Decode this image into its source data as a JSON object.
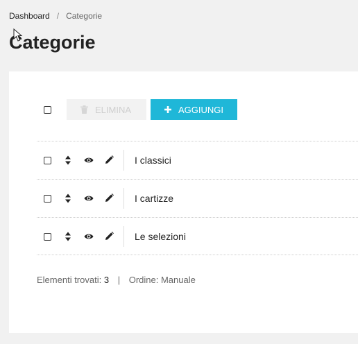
{
  "breadcrumb": {
    "home": "Dashboard",
    "separator": "/",
    "current": "Categorie"
  },
  "page": {
    "title": "Categorie"
  },
  "toolbar": {
    "delete_label": "ELIMINA",
    "add_label": "AGGIUNGI"
  },
  "categories": [
    {
      "label": "I classici"
    },
    {
      "label": "I cartizze"
    },
    {
      "label": "Le selezioni"
    }
  ],
  "footer": {
    "found_label": "Elementi trovati:",
    "found_count": "3",
    "separator": "|",
    "order_label": "Ordine: Manuale"
  },
  "colors": {
    "accent": "#1fb7d8",
    "background": "#f1f1f1",
    "card": "#ffffff"
  },
  "icons": {
    "delete": "trash-icon",
    "add": "plus-icon",
    "sort": "sort-icon",
    "view": "eye-icon",
    "edit": "pencil-icon"
  }
}
